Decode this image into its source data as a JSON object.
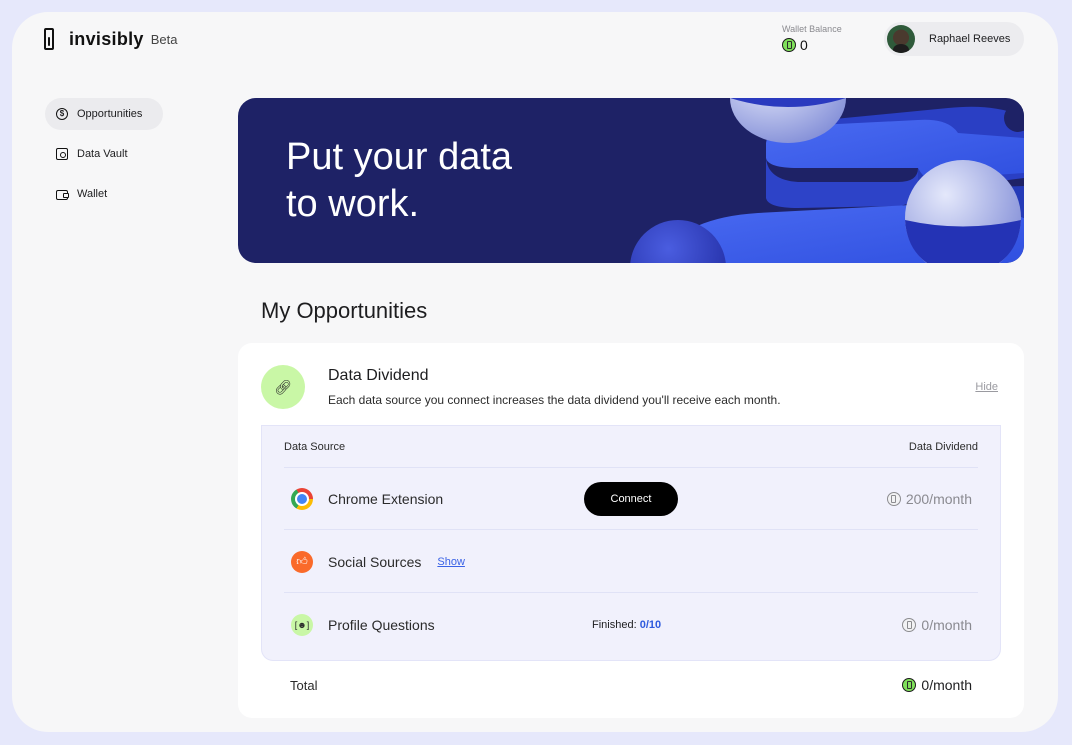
{
  "header": {
    "logo_text": "invisibly",
    "logo_badge": "Beta",
    "wallet_label": "Wallet Balance",
    "wallet_value": "0",
    "user_name": "Raphael Reeves"
  },
  "sidebar": {
    "items": [
      {
        "label": "Opportunities",
        "icon": "dollar-circle-icon",
        "active": true
      },
      {
        "label": "Data Vault",
        "icon": "vault-icon",
        "active": false
      },
      {
        "label": "Wallet",
        "icon": "wallet-icon",
        "active": false
      }
    ]
  },
  "banner": {
    "title_line1": "Put your data",
    "title_line2": "to work."
  },
  "section_title": "My Opportunities",
  "dividend_card": {
    "icon": "link-icon",
    "title": "Data Dividend",
    "description": "Each data source you connect increases the data dividend you'll receive each month.",
    "hide_label": "Hide",
    "columns": {
      "source": "Data Source",
      "dividend": "Data Dividend"
    },
    "rows": [
      {
        "name": "Chrome Extension",
        "icon": "chrome-icon",
        "action_label": "Connect",
        "dividend": "200/month"
      },
      {
        "name": "Social Sources",
        "icon": "thumbs-up-icon",
        "link_label": "Show"
      },
      {
        "name": "Profile Questions",
        "icon": "profile-scan-icon",
        "finished_label": "Finished:",
        "finished_value": "0/10",
        "dividend": "0/month"
      }
    ],
    "total_label": "Total",
    "total_value": "0/month"
  },
  "colors": {
    "banner_bg": "#1e2266",
    "accent_green": "#c9f7a6",
    "coin_green": "#7fe05a",
    "link_blue": "#3a62e6",
    "social_orange": "#fa6a2a"
  }
}
